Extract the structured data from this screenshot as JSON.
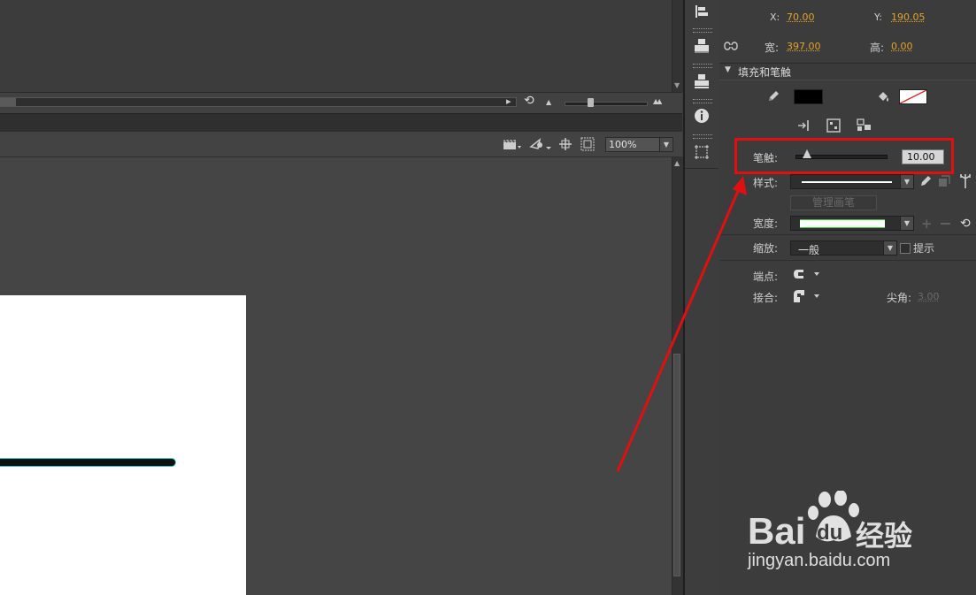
{
  "timeline": {
    "scroll_right_arrow": "▸",
    "loop_icon": "⟲",
    "zoom_small_icon": "▲",
    "zoom_large_icon": "▲▲",
    "zoom_level": 0.3
  },
  "stage_toolbar": {
    "zoom_value": "100%"
  },
  "tool_column": {
    "buttons": [
      "align-left-icon",
      "distribute-icon",
      "align-bottom-icon",
      "info-icon",
      "transform-icon"
    ]
  },
  "position": {
    "x_label": "X:",
    "x_value": "70.00",
    "y_label": "Y:",
    "y_value": "190.05",
    "w_label": "宽:",
    "w_value": "397.00",
    "h_label": "高:",
    "h_value": "0.00"
  },
  "fill_stroke": {
    "title": "填充和笔触",
    "stroke_color": "#000000",
    "fill_color": "none"
  },
  "stroke": {
    "label": "笔触:",
    "value": "10.00",
    "slider_level": 0.12,
    "style_label": "样式:",
    "manage_brush": "管理画笔",
    "width_label": "宽度:",
    "scale_label": "缩放:",
    "scale_value": "一般",
    "hint_label": "提示",
    "cap_label": "端点:",
    "join_label": "接合:",
    "miter_label": "尖角:",
    "miter_value": "3.00"
  },
  "watermark": {
    "brand": "Bai",
    "brand_du": "du",
    "brand_cn": "经验",
    "url": "jingyan.baidu.com"
  },
  "colors": {
    "highlight_box": "#e01010",
    "arrow": "#e01010",
    "accent_value": "#e3a328"
  }
}
